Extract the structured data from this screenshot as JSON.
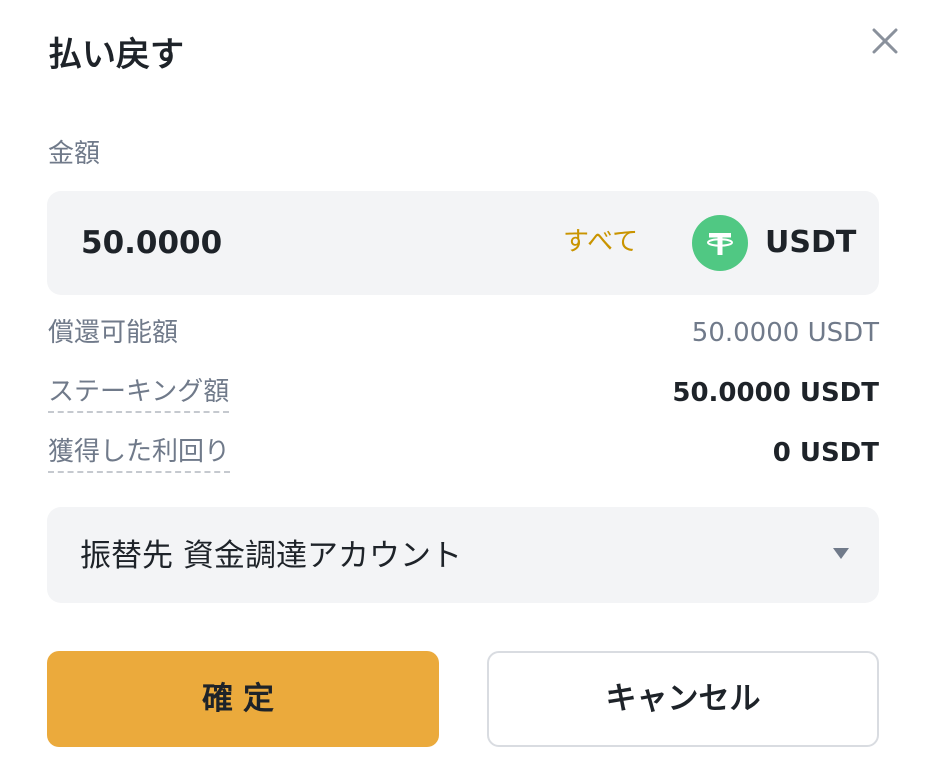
{
  "dialog": {
    "title": "払い戻す",
    "close_icon": "close-icon"
  },
  "amount": {
    "label": "金額",
    "value": "50.0000",
    "max_label": "すべて",
    "coin_icon": "tether-icon",
    "coin_icon_color": "#50c883",
    "coin": "USDT"
  },
  "details": [
    {
      "label": "償還可能額",
      "value": "50.0000 USDT"
    },
    {
      "label": "ステーキング額",
      "value": "50.0000 USDT"
    },
    {
      "label": "獲得した利回り",
      "value": "0 USDT"
    }
  ],
  "destination": {
    "prefix": "振替先",
    "account": "資金調達アカウント",
    "caret_icon": "caret-down-icon"
  },
  "buttons": {
    "confirm": "確定",
    "cancel": "キャンセル",
    "confirm_color": "#ebaa3c"
  },
  "colors": {
    "accent_text": "#c99400",
    "muted_text": "#707a8a",
    "field_bg": "#f3f4f6"
  }
}
